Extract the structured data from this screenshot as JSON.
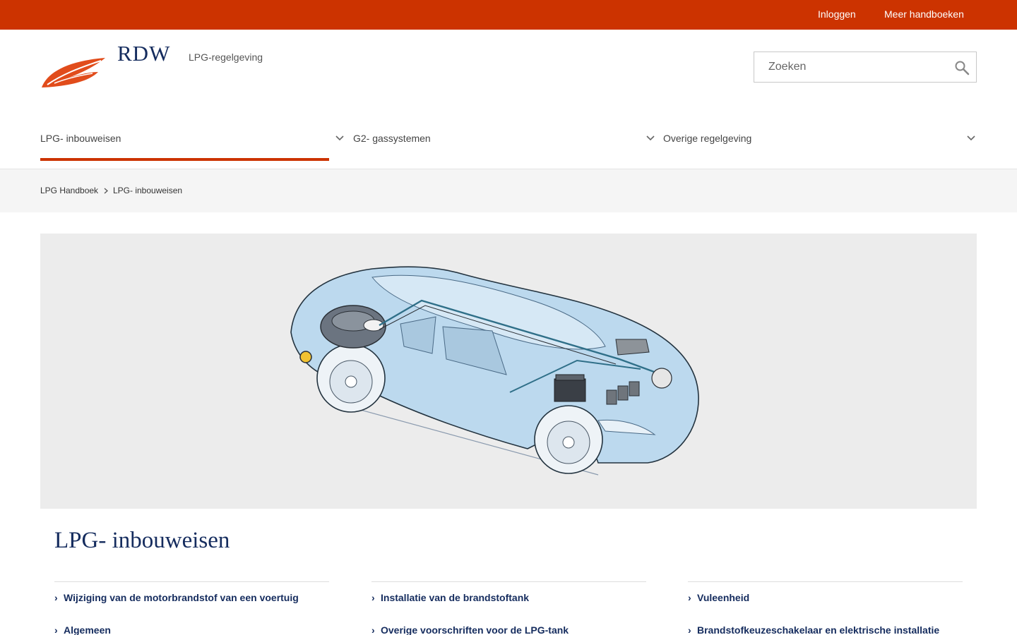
{
  "topbar": {
    "login": "Inloggen",
    "more": "Meer handboeken"
  },
  "header": {
    "logo_text": "RDW",
    "site_name": "LPG-regelgeving"
  },
  "search": {
    "placeholder": "Zoeken"
  },
  "nav": {
    "items": [
      {
        "label": "LPG- inbouweisen"
      },
      {
        "label": "G2- gassystemen"
      },
      {
        "label": "Overige regelgeving"
      }
    ]
  },
  "breadcrumb": {
    "root": "LPG Handboek",
    "current": "LPG- inbouweisen"
  },
  "main": {
    "title": "LPG- inbouweisen",
    "columns": [
      {
        "links": [
          "Wijziging van de motorbrandstof van een voertuig",
          "Algemeen"
        ]
      },
      {
        "links": [
          "Installatie van de brandstoftank",
          "Overige voorschriften voor de LPG-tank"
        ]
      },
      {
        "links": [
          "Vuleenheid",
          "Brandstofkeuzeschakelaar en elektrische installatie"
        ]
      }
    ]
  },
  "colors": {
    "brand_red": "#cc3300",
    "navy": "#152c5e"
  }
}
